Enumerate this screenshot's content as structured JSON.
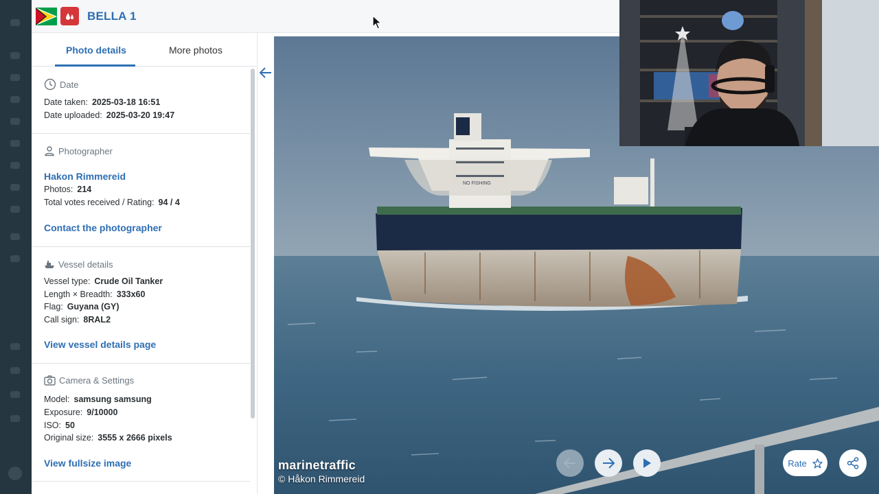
{
  "header": {
    "vessel_name": "BELLA 1",
    "flag_icon": "guyana-flag-icon",
    "type_icon": "tanker-drop-icon"
  },
  "tabs": [
    {
      "label": "Photo details",
      "active": true
    },
    {
      "label": "More photos",
      "active": false
    }
  ],
  "date": {
    "heading": "Date",
    "taken_label": "Date taken:",
    "taken_value": "2025-03-18 16:51",
    "uploaded_label": "Date uploaded:",
    "uploaded_value": "2025-03-20 19:47"
  },
  "photographer": {
    "heading": "Photographer",
    "name": "Hakon Rimmereid",
    "photos_label": "Photos:",
    "photos_value": "214",
    "votes_label": "Total votes received / Rating:",
    "votes_value": "94 / 4",
    "contact_link": "Contact the photographer"
  },
  "vessel": {
    "heading": "Vessel details",
    "type_label": "Vessel type:",
    "type_value": "Crude Oil Tanker",
    "size_label": "Length × Breadth:",
    "size_value": "333x60",
    "flag_label": "Flag:",
    "flag_value": "Guyana (GY)",
    "call_label": "Call sign:",
    "call_value": "8RAL2",
    "details_link": "View vessel details page"
  },
  "camera": {
    "heading": "Camera & Settings",
    "model_label": "Model:",
    "model_value": "samsung samsung",
    "exposure_label": "Exposure:",
    "exposure_value": "9/10000",
    "iso_label": "ISO:",
    "iso_value": "50",
    "size_label": "Original size:",
    "size_value": "3555 x 2666 pixels",
    "fullsize_link": "View fullsize image"
  },
  "viewer": {
    "watermark_brand": "marinetraffic",
    "watermark_copy": "© Håkon Rimmereid",
    "rate_label": "Rate",
    "ship_hull_text": "NO FISHING"
  },
  "colors": {
    "accent": "#2e6eb3",
    "tanker_badge": "#d4363a"
  }
}
